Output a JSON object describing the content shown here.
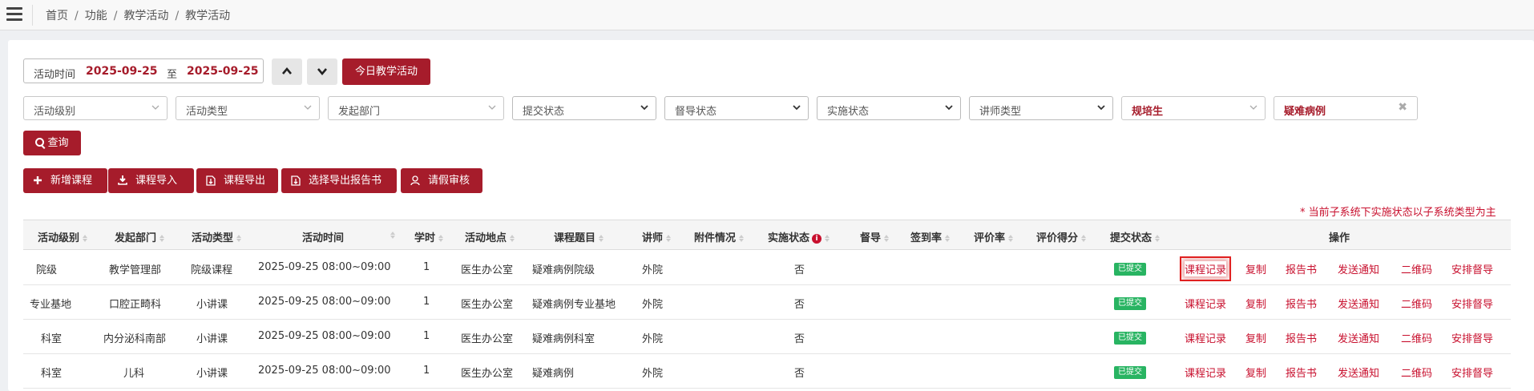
{
  "breadcrumb": [
    "首页",
    "功能",
    "教学活动",
    "教学活动"
  ],
  "filters": {
    "time_label": "活动时间",
    "date_from": "2025-09-25",
    "to_label": "至",
    "date_to": "2025-09-25",
    "today_button": "今日教学活动",
    "activity_level": "活动级别",
    "activity_type": "活动类型",
    "department": "发起部门",
    "submit_status": "提交状态",
    "supervise_status": "督导状态",
    "implement_status": "实施状态",
    "lecturer_type": "讲师类型",
    "trainee": "规培生",
    "case_type": "疑难病例",
    "query_button": "查询"
  },
  "actions": {
    "add": "新增课程",
    "import": "课程导入",
    "export": "课程导出",
    "export_report": "选择导出报告书",
    "leave_review": "请假审核"
  },
  "notice": "* 当前子系统下实施状态以子系统类型为主",
  "columns": {
    "level": "活动级别",
    "dept": "发起部门",
    "type": "活动类型",
    "time": "活动时间",
    "hours": "学时",
    "place": "活动地点",
    "topic": "课程题目",
    "lecturer": "讲师",
    "attach": "附件情况",
    "impl": "实施状态",
    "supervise": "督导",
    "signin": "签到率",
    "rating": "评价率",
    "score": "评价得分",
    "submit": "提交状态",
    "ops": "操作"
  },
  "rows": [
    {
      "level": "院级",
      "dept": "教学管理部",
      "type": "院级课程",
      "time": "2025-09-25  08:00~09:00",
      "hours": "1",
      "place": "医生办公室",
      "topic": "疑难病例院级",
      "lecturer": "外院",
      "impl": "否",
      "submit": "已提交"
    },
    {
      "level": "专业基地",
      "dept": "口腔正畸科",
      "type": "小讲课",
      "time": "2025-09-25  08:00~09:00",
      "hours": "1",
      "place": "医生办公室",
      "topic": "疑难病例专业基地",
      "lecturer": "外院",
      "impl": "否",
      "submit": "已提交"
    },
    {
      "level": "科室",
      "dept": "内分泌科南部",
      "type": "小讲课",
      "time": "2025-09-25  08:00~09:00",
      "hours": "1",
      "place": "医生办公室",
      "topic": "疑难病例科室",
      "lecturer": "外院",
      "impl": "否",
      "submit": "已提交"
    },
    {
      "level": "科室",
      "dept": "儿科",
      "type": "小讲课",
      "time": "2025-09-25  08:00~09:00",
      "hours": "1",
      "place": "医生办公室",
      "topic": "疑难病例",
      "lecturer": "外院",
      "impl": "否",
      "submit": "已提交"
    }
  ],
  "row_ops": {
    "record": "课程记录",
    "copy": "复制",
    "report": "报告书",
    "notify": "发送通知",
    "qrcode": "二维码",
    "supervise": "安排督导"
  },
  "colors": {
    "accent": "#a61c2b",
    "link": "#c8102e",
    "badge": "#28b462"
  }
}
